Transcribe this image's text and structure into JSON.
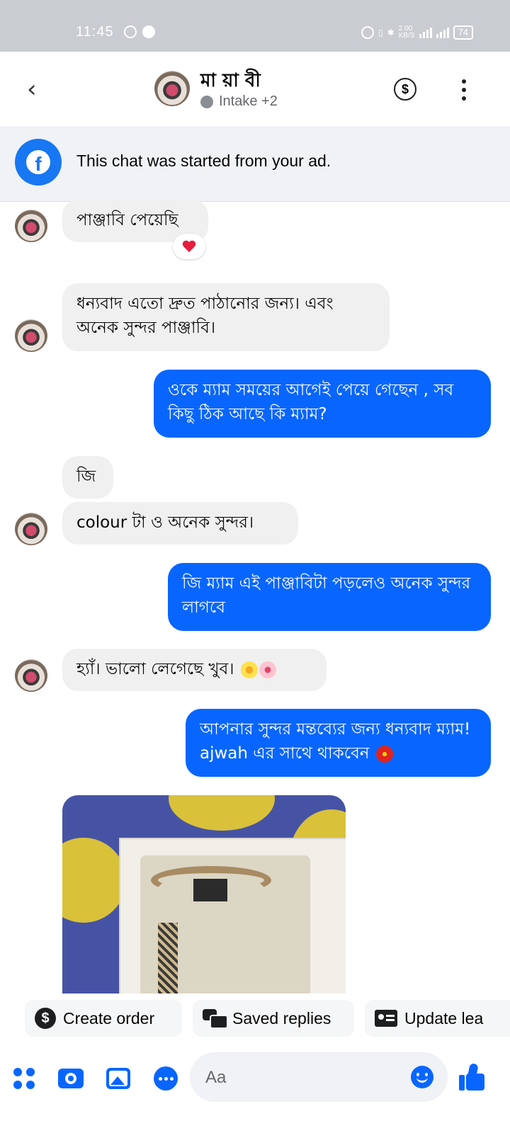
{
  "status_bar": {
    "time": "11:45",
    "speed_top": "2.00",
    "speed_bottom": "KB/S",
    "battery": "74"
  },
  "header": {
    "back_icon": "chevron-left-icon",
    "contact_name": "মা য়া বী",
    "subtitle": "Intake +2"
  },
  "ad_banner": {
    "text": "This chat was started from your ad."
  },
  "messages": [
    {
      "side": "in",
      "text": "পাঞ্জাবি পেয়েছি",
      "reaction": "red-heart"
    },
    {
      "side": "in",
      "text": "ধন্যবাদ এতো দ্রুত পাঠানোর জন্য। এবং অনেক সুন্দর পাঞ্জাবি।"
    },
    {
      "side": "out",
      "text": "ওকে ম্যাম সময়ের আগেই পেয়ে গেছেন , সব কিছু ঠিক আছে কি ম্যাম?"
    },
    {
      "side": "in",
      "text": "জি"
    },
    {
      "side": "in",
      "text": "colour টা ও অনেক সুন্দর।"
    },
    {
      "side": "out",
      "text": "জি ম্যাম এই পাঞ্জাবিটা পড়লেও অনেক সুন্দর লাগবে"
    },
    {
      "side": "in",
      "text": "হ্যাঁ। ভালো লেগেছে খুব।",
      "emoji": [
        "blossom-daisy",
        "cherry-blossom"
      ]
    },
    {
      "side": "out",
      "text": "আপনার সুন্দর মন্তব্যের জন্য ধন্যবাদ ম্যাম! ajwah এর সাথে থাকবেন",
      "emoji": [
        "hibiscus"
      ]
    },
    {
      "side": "in",
      "type": "photo",
      "subject": "boxed panjabi photo"
    }
  ],
  "quick_actions": [
    {
      "label": "Create order",
      "icon": "dollar-icon"
    },
    {
      "label": "Saved replies",
      "icon": "saved-replies-icon"
    },
    {
      "label": "Update lea",
      "icon": "contact-card-icon"
    }
  ],
  "composer": {
    "placeholder": "Aa"
  },
  "colors": {
    "accent": "#0866ff",
    "incoming_bubble": "#f0f0f0",
    "status_bar": "#c9ccd1",
    "facebook_blue": "#1877f2"
  }
}
